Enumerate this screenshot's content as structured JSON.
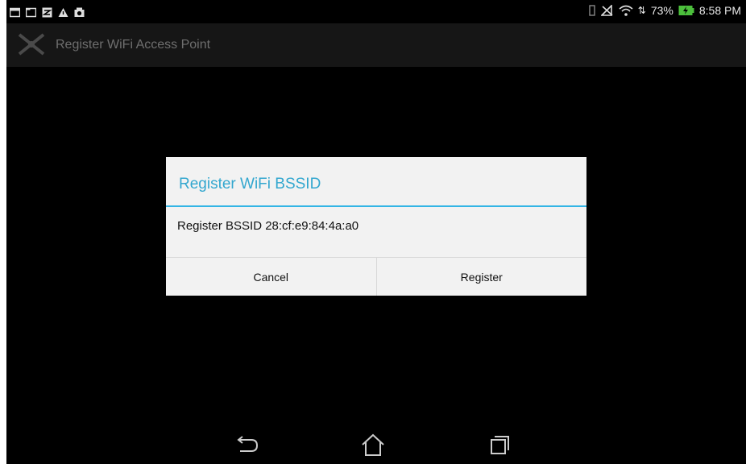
{
  "status_bar": {
    "battery_percent": "73%",
    "time": "8:58 PM",
    "left_icons": [
      "screen-icon",
      "window-icon",
      "zip-icon",
      "warning-icon",
      "camera-icon"
    ],
    "right_icons": [
      "vibrate-icon",
      "no-signal-icon",
      "wifi-icon",
      "battery-charging-icon"
    ]
  },
  "action_bar": {
    "title": "Register WiFi Access Point",
    "icon": "app-logo-icon"
  },
  "dialog": {
    "title": "Register WiFi BSSID",
    "message": "Register BSSID 28:cf:e9:84:4a:a0",
    "cancel_label": "Cancel",
    "register_label": "Register",
    "accent_color": "#33b5e5"
  },
  "nav_bar": {
    "buttons": [
      "back-icon",
      "home-icon",
      "recent-apps-icon"
    ]
  }
}
